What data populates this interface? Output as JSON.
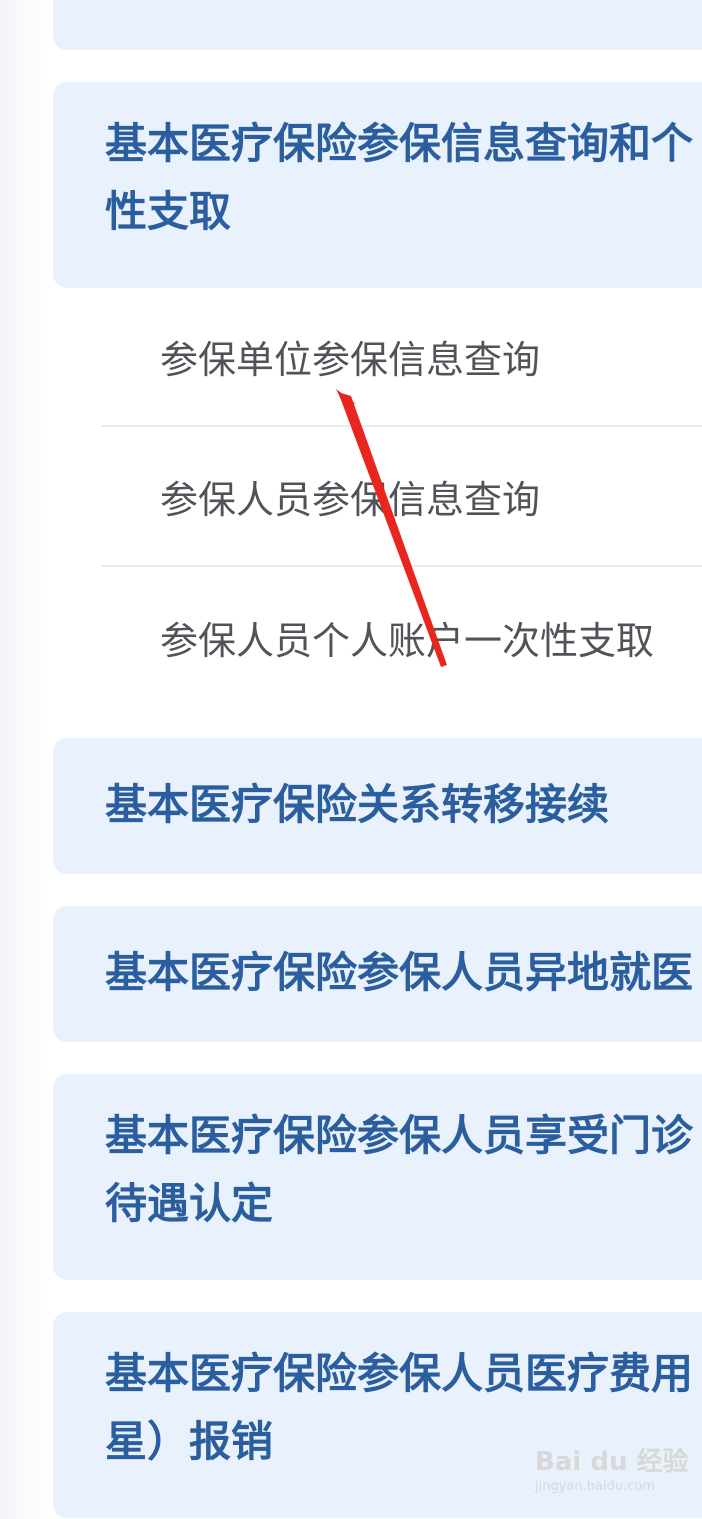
{
  "sections": [
    {
      "title_lines": [
        ""
      ]
    },
    {
      "title_lines": [
        "基本医疗保险参保信息查询和个",
        "性支取"
      ]
    },
    {
      "title_lines": [
        "基本医疗保险关系转移接续"
      ]
    },
    {
      "title_lines": [
        "基本医疗保险参保人员异地就医"
      ]
    },
    {
      "title_lines": [
        "基本医疗保险参保人员享受门诊",
        "待遇认定"
      ]
    },
    {
      "title_lines": [
        "基本医疗保险参保人员医疗费用",
        "星）报销"
      ]
    }
  ],
  "sub_items": [
    {
      "label": "参保单位参保信息查询"
    },
    {
      "label": "参保人员参保信息查询"
    },
    {
      "label": "参保人员个人账户一次性支取"
    }
  ],
  "watermark": {
    "brand": "Bai du 经验",
    "url": "jingyan.baidu.com"
  },
  "colors": {
    "card_bg": "#e8f1fc",
    "title_text": "#2b5e9e",
    "sub_text": "#505357",
    "divider": "#e8ebef",
    "annotation_arrow": "#e8261f"
  }
}
